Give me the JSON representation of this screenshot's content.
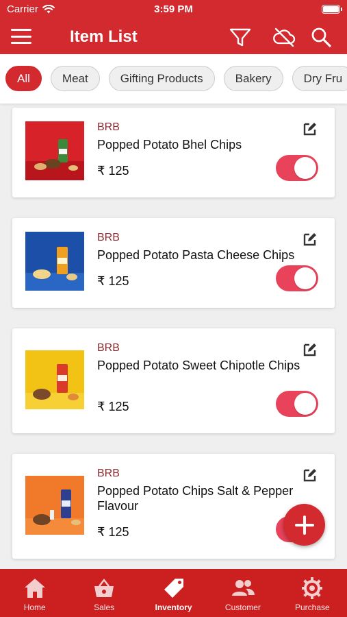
{
  "status_bar": {
    "carrier": "Carrier",
    "time": "3:59 PM"
  },
  "header": {
    "title": "Item List",
    "icons": [
      "menu-icon",
      "filter-icon",
      "cloud-off-icon",
      "search-icon"
    ]
  },
  "categories": [
    {
      "label": "All",
      "active": true
    },
    {
      "label": "Meat",
      "active": false
    },
    {
      "label": "Gifting Products",
      "active": false
    },
    {
      "label": "Bakery",
      "active": false
    },
    {
      "label": "Dry Fru",
      "active": false
    }
  ],
  "items": [
    {
      "brand": "BRB",
      "name": "Popped Potato Bhel Chips",
      "price": "₹ 125",
      "enabled": true,
      "image_bg": "#d8222a"
    },
    {
      "brand": "BRB",
      "name": "Popped Potato Pasta Cheese Chips",
      "price": "₹ 125",
      "enabled": true,
      "image_bg": "#1c4fa8"
    },
    {
      "brand": "BRB",
      "name": "Popped Potato Sweet Chipotle Chips",
      "price": "₹ 125",
      "enabled": true,
      "image_bg": "#f2c314"
    },
    {
      "brand": "BRB",
      "name": "Popped Potato Chips Salt & Pepper Flavour",
      "price": "₹ 125",
      "enabled": true,
      "image_bg": "#f07a2a"
    }
  ],
  "tabs": [
    {
      "label": "Home",
      "icon": "home-icon",
      "active": false
    },
    {
      "label": "Sales",
      "icon": "basket-icon",
      "active": false
    },
    {
      "label": "Inventory",
      "icon": "tag-icon",
      "active": true
    },
    {
      "label": "Customer",
      "icon": "people-icon",
      "active": false
    },
    {
      "label": "Purchase",
      "icon": "gear-icon",
      "active": false
    }
  ],
  "colors": {
    "primary": "#d22a2e",
    "toggle_on": "#e8435a",
    "brand_text": "#8b2a2e"
  }
}
